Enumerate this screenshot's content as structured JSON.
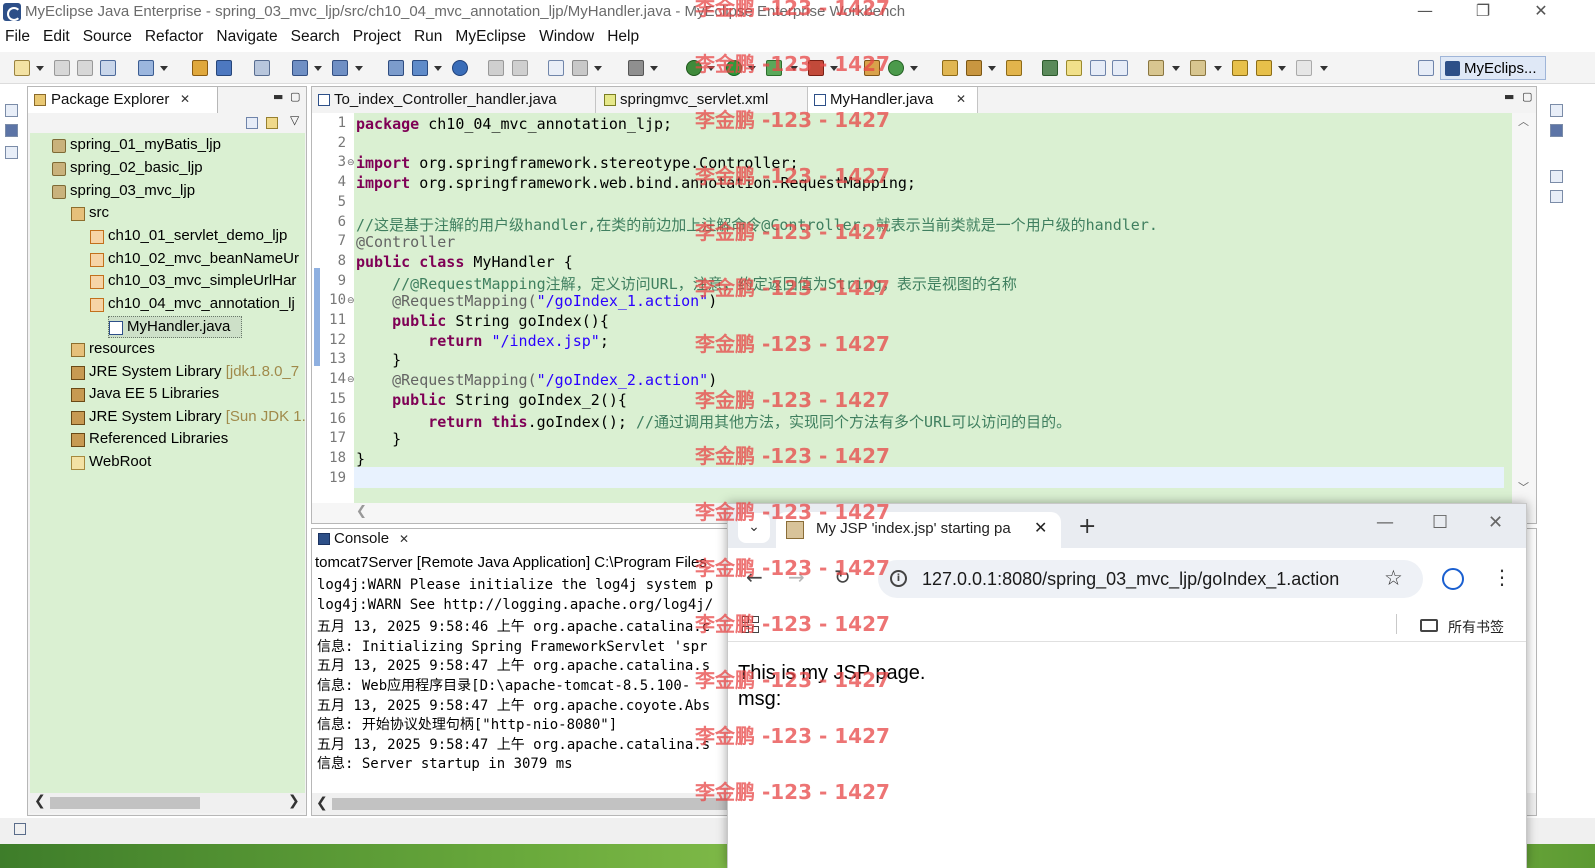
{
  "window": {
    "title": "MyEclipse Java Enterprise - spring_03_mvc_ljp/src/ch10_04_mvc_annotation_ljp/MyHandler.java - MyEclipse Enterprise Workbench",
    "minimize": "—",
    "maximize": "❐",
    "close": "✕"
  },
  "menu": [
    "File",
    "Edit",
    "Source",
    "Refactor",
    "Navigate",
    "Search",
    "Project",
    "Run",
    "MyEclipse",
    "Window",
    "Help"
  ],
  "perspective": {
    "label": "MyEclips..."
  },
  "package_explorer": {
    "title": "Package Explorer",
    "tree": [
      {
        "label": "spring_01_myBatis_ljp",
        "icon": "project-icon",
        "indent": 0
      },
      {
        "label": "spring_02_basic_ljp",
        "icon": "project-icon",
        "indent": 0
      },
      {
        "label": "spring_03_mvc_ljp",
        "icon": "project-icon",
        "indent": 0
      },
      {
        "label": "src",
        "icon": "source-folder-icon",
        "indent": 1
      },
      {
        "label": "ch10_01_servlet_demo_ljp",
        "icon": "package-icon",
        "indent": 2
      },
      {
        "label": "ch10_02_mvc_beanNameUr",
        "icon": "package-icon",
        "indent": 2
      },
      {
        "label": "ch10_03_mvc_simpleUrlHar",
        "icon": "package-icon",
        "indent": 2
      },
      {
        "label": "ch10_04_mvc_annotation_lj",
        "icon": "package-icon",
        "indent": 2
      },
      {
        "label": "MyHandler.java",
        "icon": "java-file-icon",
        "indent": 3
      },
      {
        "label": "resources",
        "icon": "source-folder-icon",
        "indent": 1
      },
      {
        "label": "JRE System Library",
        "decoration": "[jdk1.8.0_7",
        "icon": "library-icon",
        "indent": 1
      },
      {
        "label": "Java EE 5 Libraries",
        "icon": "library-icon",
        "indent": 1
      },
      {
        "label": "JRE System Library",
        "decoration": "[Sun JDK 1.",
        "icon": "library-icon",
        "indent": 1
      },
      {
        "label": "Referenced Libraries",
        "icon": "library-icon",
        "indent": 1
      },
      {
        "label": "WebRoot",
        "icon": "folder-icon",
        "indent": 1
      }
    ]
  },
  "editor": {
    "tabs": [
      {
        "label": "To_index_Controller_handler.java"
      },
      {
        "label": "springmvc_servlet.xml"
      },
      {
        "label": "MyHandler.java"
      }
    ],
    "code": [
      [
        {
          "t": "package",
          "c": "kw"
        },
        {
          "t": " ch10_04_mvc_annotation_ljp;",
          "c": ""
        }
      ],
      [],
      [
        {
          "t": "import",
          "c": "kw"
        },
        {
          "t": " org.springframework.stereotype.Controller;",
          "c": ""
        }
      ],
      [
        {
          "t": "import",
          "c": "kw"
        },
        {
          "t": " org.springframework.web.bind.annotation.RequestMapping;",
          "c": ""
        }
      ],
      [],
      [
        {
          "t": "//这是基于注解的用户级handler,在类的前边加上注解命令@Controller，就表示当前类就是一个用户级的handler.",
          "c": "cmt"
        }
      ],
      [
        {
          "t": "@Controller",
          "c": "ann"
        }
      ],
      [
        {
          "t": "public",
          "c": "kw"
        },
        {
          "t": " ",
          "c": ""
        },
        {
          "t": "class",
          "c": "kw"
        },
        {
          "t": " MyHandler {",
          "c": ""
        }
      ],
      [
        {
          "t": "    //@RequestMapping注解，定义访问URL，注意，约定返回值为String，表示是视图的名称",
          "c": "cmt"
        }
      ],
      [
        {
          "t": "    @RequestMapping(",
          "c": "ann"
        },
        {
          "t": "\"/goIndex_1.action\"",
          "c": "str"
        },
        {
          "t": ")",
          "c": ""
        }
      ],
      [
        {
          "t": "    ",
          "c": ""
        },
        {
          "t": "public",
          "c": "kw"
        },
        {
          "t": " String goIndex(){",
          "c": ""
        }
      ],
      [
        {
          "t": "        ",
          "c": ""
        },
        {
          "t": "return",
          "c": "kw"
        },
        {
          "t": " ",
          "c": ""
        },
        {
          "t": "\"/index.jsp\"",
          "c": "str"
        },
        {
          "t": ";",
          "c": ""
        }
      ],
      [
        {
          "t": "    }",
          "c": ""
        }
      ],
      [
        {
          "t": "    @RequestMapping(",
          "c": "ann"
        },
        {
          "t": "\"/goIndex_2.action\"",
          "c": "str"
        },
        {
          "t": ")",
          "c": ""
        }
      ],
      [
        {
          "t": "    ",
          "c": ""
        },
        {
          "t": "public",
          "c": "kw"
        },
        {
          "t": " String goIndex_2(){",
          "c": ""
        }
      ],
      [
        {
          "t": "        ",
          "c": ""
        },
        {
          "t": "return",
          "c": "kw"
        },
        {
          "t": " ",
          "c": ""
        },
        {
          "t": "this",
          "c": "kw"
        },
        {
          "t": ".goIndex(); ",
          "c": ""
        },
        {
          "t": "//通过调用其他方法，实现同个方法有多个URL可以访问的目的。",
          "c": "cmt"
        }
      ],
      [
        {
          "t": "    }",
          "c": ""
        }
      ],
      [
        {
          "t": "}",
          "c": ""
        }
      ],
      []
    ]
  },
  "console": {
    "title": "Console",
    "description": "tomcat7Server [Remote Java Application] C:\\Program Files",
    "lines": [
      "log4j:WARN Please initialize the log4j system p",
      "log4j:WARN See http://logging.apache.org/log4j/",
      "五月 13, 2025 9:58:46 上午 org.apache.catalina.c",
      "信息: Initializing Spring FrameworkServlet 'spr",
      "五月 13, 2025 9:58:47 上午 org.apache.catalina.s",
      "信息: Web应用程序目录[D:\\apache-tomcat-8.5.100-",
      "五月 13, 2025 9:58:47 上午 org.apache.coyote.Abs",
      "信息: 开始协议处理句柄[\"http-nio-8080\"]",
      "五月 13, 2025 9:58:47 上午 org.apache.catalina.s",
      "信息: Server startup in 3079 ms"
    ]
  },
  "browser": {
    "tab_title": "My JSP 'index.jsp' starting pa",
    "tab_close": "✕",
    "new_tab": "+",
    "url": "127.0.0.1:8080/spring_03_mvc_ljp/goIndex_1.action",
    "bookmarks_label": "所有书签",
    "page_line1": "This is my JSP page.",
    "page_line2": "msg:"
  },
  "watermark": {
    "text": "李金鹏 -123 - 1427",
    "color": "#e84646"
  }
}
